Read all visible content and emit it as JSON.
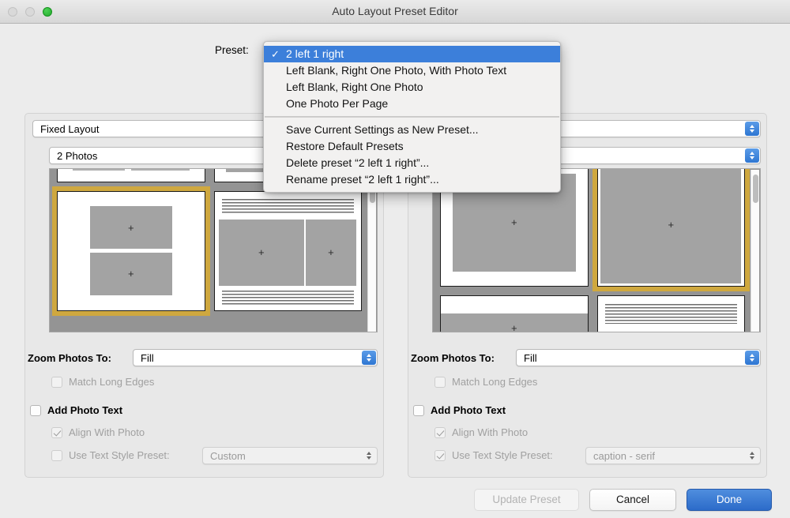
{
  "window": {
    "title": "Auto Layout Preset Editor",
    "traffic_lights": [
      "close",
      "minimize",
      "zoom"
    ]
  },
  "preset_row": {
    "label": "Preset:"
  },
  "preset_menu": {
    "open": true,
    "highlight_color": "#3c7fda",
    "checkmark": "✓",
    "items": [
      {
        "label": "2 left 1 right",
        "checked": true,
        "selected": true
      },
      {
        "label": "Left Blank, Right One Photo, With Photo Text",
        "checked": false,
        "selected": false
      },
      {
        "label": "Left Blank, Right One Photo",
        "checked": false,
        "selected": false
      },
      {
        "label": "One Photo Per Page",
        "checked": false,
        "selected": false
      }
    ],
    "actions": [
      {
        "label": "Save Current Settings as New Preset..."
      },
      {
        "label": "Restore Default Presets"
      },
      {
        "label": "Delete preset “2 left 1 right”..."
      },
      {
        "label": "Rename preset “2 left 1 right”..."
      }
    ]
  },
  "left_panel": {
    "layout_mode": "Fixed Layout",
    "photo_count": "2 Photos",
    "zoom_label": "Zoom Photos To:",
    "zoom_value": "Fill",
    "match_long_edges": {
      "label": "Match Long Edges",
      "checked": false,
      "enabled": false
    },
    "add_photo_text": {
      "label": "Add Photo Text",
      "checked": false,
      "enabled": true
    },
    "align_with_photo": {
      "label": "Align With Photo",
      "checked": true,
      "enabled": false
    },
    "use_text_style_preset": {
      "label": "Use Text Style Preset:",
      "checked": false,
      "enabled": false
    },
    "text_style_value": "Custom",
    "selection_color": "#cfa83f"
  },
  "right_panel": {
    "zoom_label": "Zoom Photos To:",
    "zoom_value": "Fill",
    "match_long_edges": {
      "label": "Match Long Edges",
      "checked": false,
      "enabled": false
    },
    "add_photo_text": {
      "label": "Add Photo Text",
      "checked": false,
      "enabled": true
    },
    "align_with_photo": {
      "label": "Align With Photo",
      "checked": true,
      "enabled": false
    },
    "use_text_style_preset": {
      "label": "Use Text Style Preset:",
      "checked": true,
      "enabled": false
    },
    "text_style_value": "caption - serif",
    "selection_color": "#cfa83f"
  },
  "footer": {
    "update_preset": {
      "label": "Update Preset",
      "enabled": false
    },
    "cancel": {
      "label": "Cancel",
      "enabled": true
    },
    "done": {
      "label": "Done",
      "enabled": true,
      "default": true,
      "color": "#2c6bc9"
    }
  }
}
